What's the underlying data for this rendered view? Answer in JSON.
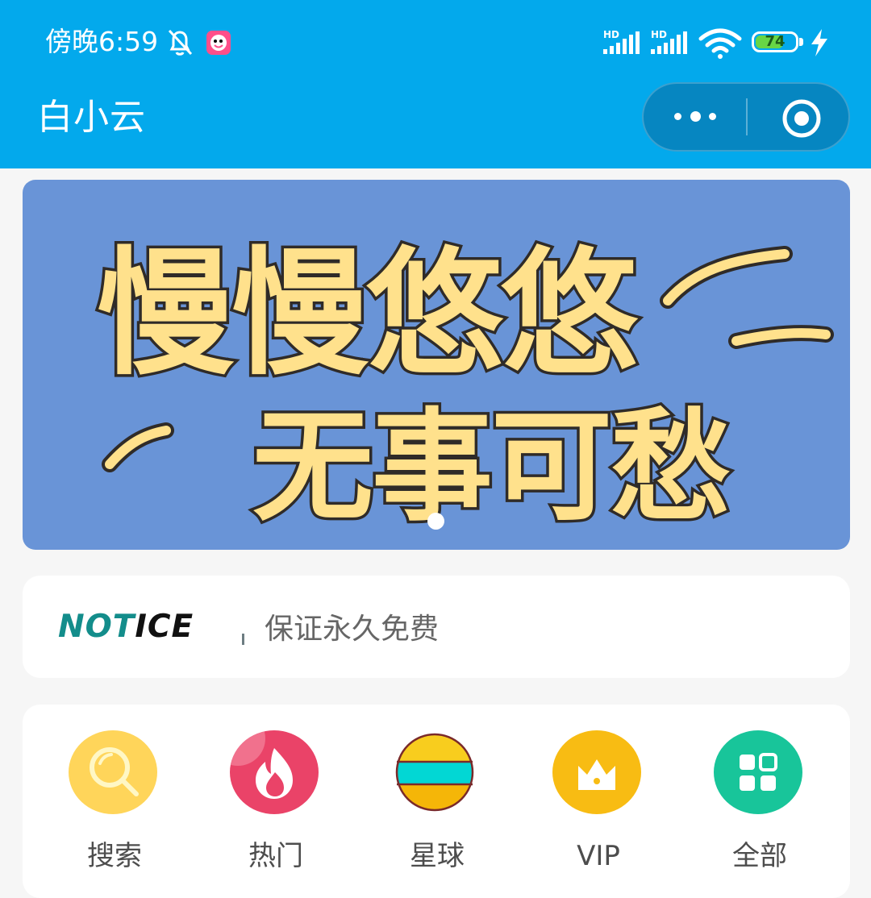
{
  "status_bar": {
    "time": "傍晚6:59",
    "signal_1": "HD",
    "signal_2": "HD",
    "battery": "74",
    "battery_percent": 74
  },
  "header": {
    "title": "白小云",
    "more_icon": "more-horizontal-icon",
    "close_icon": "miniapp-close-icon"
  },
  "banner": {
    "line1": "慢慢悠悠",
    "line2": "无事可愁",
    "slide_count": 1,
    "active_slide": 1
  },
  "notice": {
    "logo_part_1": "NOT",
    "logo_part_2": "ICE",
    "text": "保证永久免费"
  },
  "menu": {
    "items": [
      {
        "label": "搜索",
        "icon": "search-icon",
        "color": "#ffd55a"
      },
      {
        "label": "热门",
        "icon": "fire-icon",
        "color": "#ea4368"
      },
      {
        "label": "星球",
        "icon": "planet-icon",
        "color": "#02d7d4"
      },
      {
        "label": "VIP",
        "icon": "crown-icon",
        "color": "#f8bc13"
      },
      {
        "label": "全部",
        "icon": "grid-icon",
        "color": "#18c59a"
      }
    ]
  }
}
